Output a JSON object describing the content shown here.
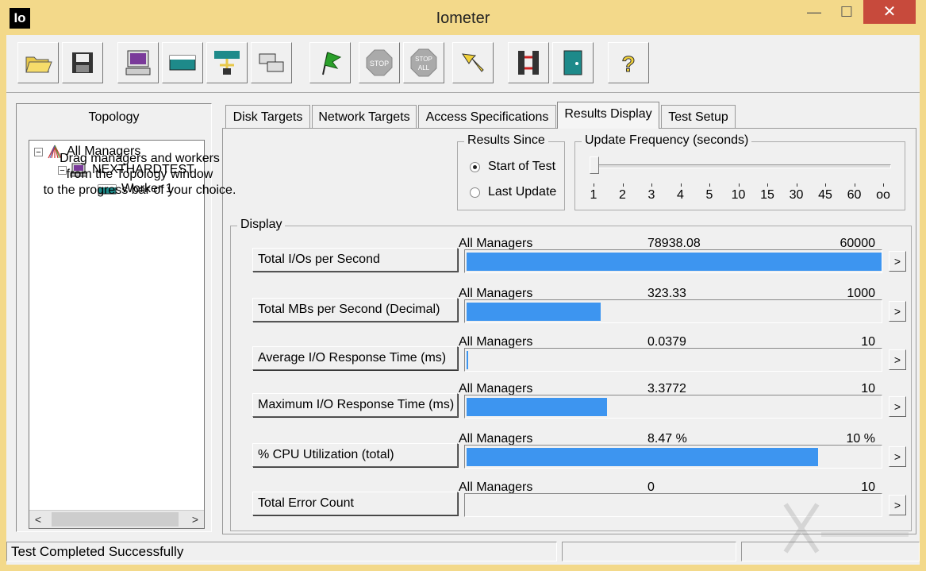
{
  "window": {
    "title": "Iometer",
    "app_icon_text": "Io",
    "minimize": "—",
    "maximize": "☐",
    "close": "✕"
  },
  "toolbar": {
    "buttons": [
      "open-config",
      "save-config",
      "start-new-manager",
      "start-new-disk-worker",
      "start-new-network-worker",
      "duplicate-worker",
      "start-tests",
      "stop-test",
      "stop-all",
      "reset-workers",
      "disconnect-managers",
      "exit",
      "about"
    ]
  },
  "topology": {
    "title": "Topology",
    "tree": [
      {
        "label": "All Managers",
        "expander": "−"
      },
      {
        "label": "NEXTHARDTEST",
        "expander": "−"
      },
      {
        "label": "Worker 1"
      }
    ],
    "scroll_left": "<",
    "scroll_right": ">"
  },
  "tabs": [
    "Disk Targets",
    "Network Targets",
    "Access Specifications",
    "Results Display",
    "Test Setup"
  ],
  "active_tab": "Results Display",
  "instructions": [
    "Drag managers and workers",
    "from the Topology window",
    "to the progress bar of your choice."
  ],
  "results_since": {
    "label": "Results Since",
    "options": [
      "Start of Test",
      "Last Update"
    ],
    "selected": "Start of Test"
  },
  "update_frequency": {
    "label": "Update Frequency (seconds)",
    "ticks": [
      "1",
      "2",
      "3",
      "4",
      "5",
      "10",
      "15",
      "30",
      "45",
      "60",
      "oo"
    ],
    "selected_index": 0
  },
  "display": {
    "label": "Display",
    "rows": [
      {
        "metric": "Total I/Os per Second",
        "source": "All Managers",
        "value": "78938.08",
        "max": "60000",
        "fraction": 1.0
      },
      {
        "metric": "Total MBs per Second (Decimal)",
        "source": "All Managers",
        "value": "323.33",
        "max": "1000",
        "fraction": 0.323
      },
      {
        "metric": "Average I/O Response Time (ms)",
        "source": "All Managers",
        "value": "0.0379",
        "max": "10",
        "fraction": 0.0038
      },
      {
        "metric": "Maximum I/O Response Time (ms)",
        "source": "All Managers",
        "value": "3.3772",
        "max": "10",
        "fraction": 0.3377
      },
      {
        "metric": "% CPU Utilization (total)",
        "source": "All Managers",
        "value": "8.47 %",
        "max": "10 %",
        "fraction": 0.847
      },
      {
        "metric": "Total Error Count",
        "source": "All Managers",
        "value": "0",
        "max": "10",
        "fraction": 0
      }
    ],
    "arrow": ">"
  },
  "status": {
    "text": "Test Completed Successfully"
  },
  "colors": {
    "bar": "#3d95f0",
    "title_bar": "#f3d98a",
    "close_button": "#c74a3c"
  }
}
